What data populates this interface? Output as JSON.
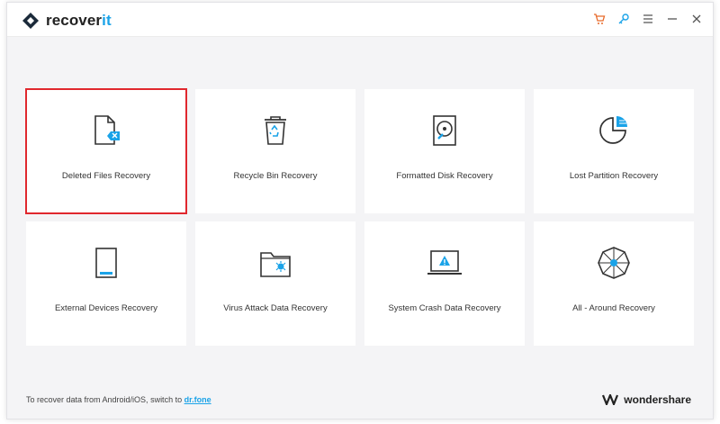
{
  "app": {
    "name_main": "recover",
    "name_accent": "it",
    "accent_color": "#1aa3e8",
    "selected_color": "#e0282e"
  },
  "titlebar": {
    "icons": [
      "cart-icon",
      "key-icon",
      "menu-icon",
      "minimize-icon",
      "close-icon"
    ]
  },
  "cards": [
    {
      "label": "Deleted Files Recovery",
      "icon": "deleted-file-icon",
      "selected": true
    },
    {
      "label": "Recycle Bin Recovery",
      "icon": "recycle-bin-icon",
      "selected": false
    },
    {
      "label": "Formatted Disk Recovery",
      "icon": "formatted-disk-icon",
      "selected": false
    },
    {
      "label": "Lost Partition Recovery",
      "icon": "partition-icon",
      "selected": false
    },
    {
      "label": "External Devices Recovery",
      "icon": "external-device-icon",
      "selected": false
    },
    {
      "label": "Virus Attack Data Recovery",
      "icon": "virus-folder-icon",
      "selected": false
    },
    {
      "label": "System Crash Data Recovery",
      "icon": "system-crash-icon",
      "selected": false
    },
    {
      "label": "All - Around Recovery",
      "icon": "all-around-icon",
      "selected": false
    }
  ],
  "footer": {
    "text": "To recover data from Android/iOS, switch to ",
    "link": "dr.fone",
    "brand": "wondershare"
  }
}
